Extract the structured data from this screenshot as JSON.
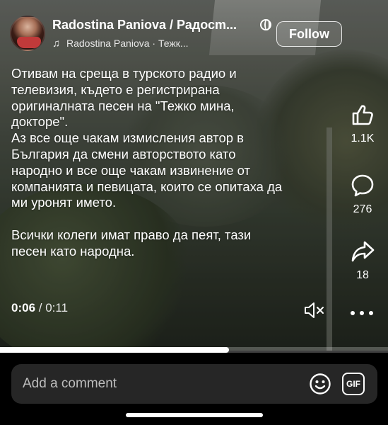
{
  "author": {
    "name": "Radostina Paniova / Радосm...",
    "sound_line": "Radostina Paniova · Тежк...",
    "follow_label": "Follow"
  },
  "caption": "Отивам на среща в турското радио и\nтелевизия, където е регистрирана\nоригиналната песен на \"Тежко мина,\nдокторе\".\nАз все още чакам измисления автор в\nБългария да смени авторството като\nнародно и все още чакам извинение от\nкомпанията и певицата, които се опитаха да\nми уронят името.\n\nВсички колеги имат право да пеят, тази\nпесен като народна.",
  "actions": {
    "likes": "1.1K",
    "comments": "276",
    "shares": "18"
  },
  "playback": {
    "current": "0:06",
    "separator": " / ",
    "duration": "0:11",
    "progress_fraction": 0.59
  },
  "comment_bar": {
    "placeholder": "Add a comment",
    "gif_label": "GIF"
  },
  "icons": {
    "music": "music-note-icon",
    "globe": "globe-icon",
    "like": "thumbs-up-icon",
    "comment": "comment-bubble-icon",
    "share": "share-arrow-icon",
    "mute": "speaker-muted-icon",
    "more": "more-dots-icon",
    "emoji": "emoji-icon",
    "gif": "gif-icon"
  },
  "colors": {
    "background": "#000000",
    "comment_bar": "#262626",
    "text": "#ffffff"
  }
}
